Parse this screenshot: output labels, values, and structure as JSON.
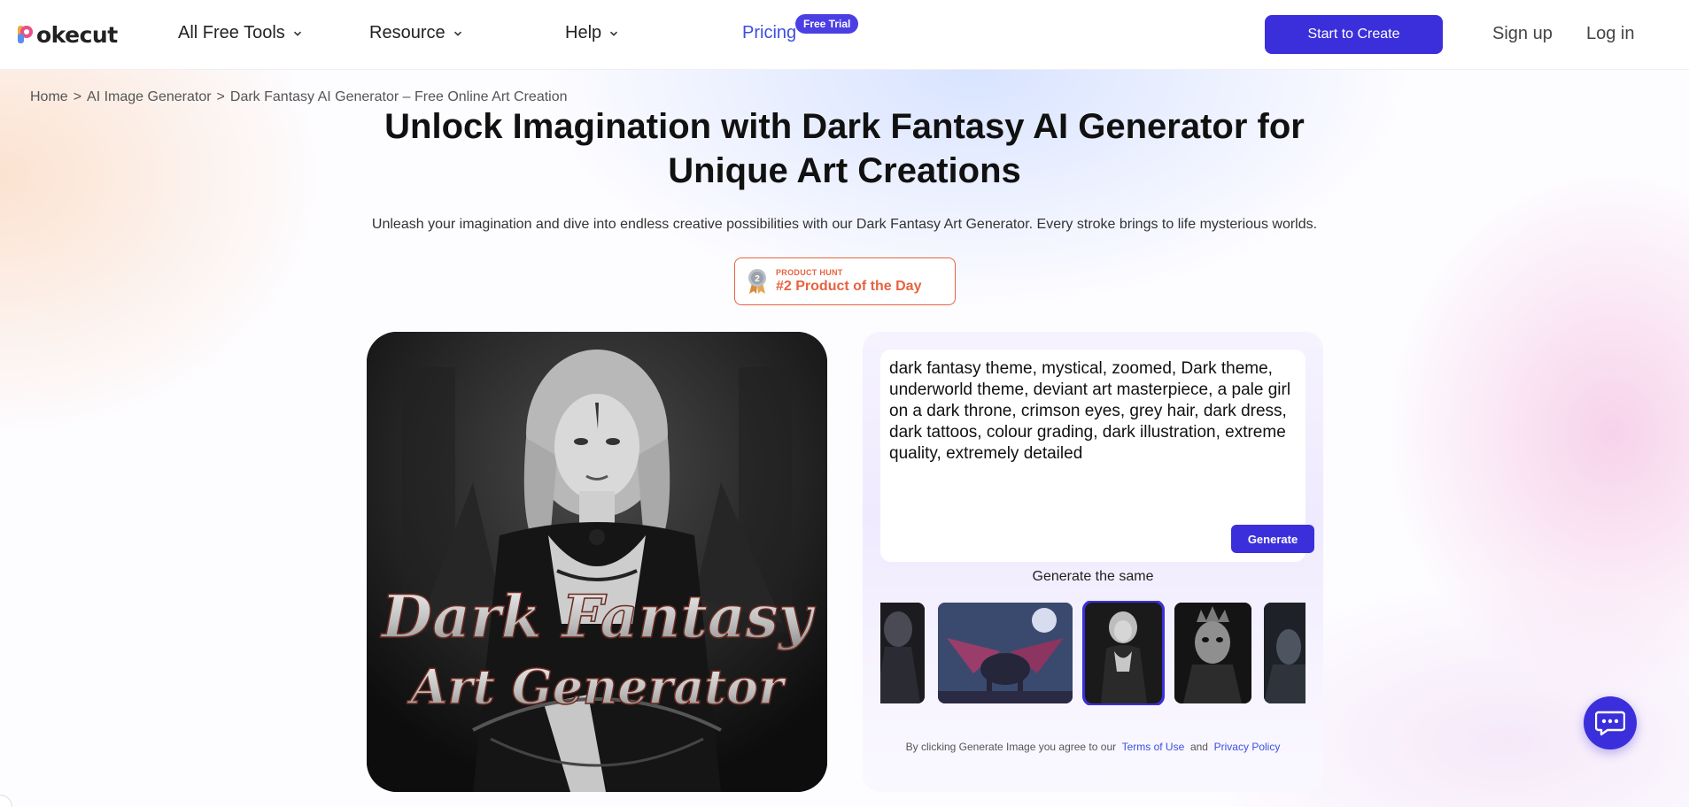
{
  "brand": {
    "name": "okecut",
    "logo_letter": "P"
  },
  "nav": {
    "items": [
      {
        "label": "All Free Tools"
      },
      {
        "label": "Resource"
      },
      {
        "label": "Help"
      }
    ],
    "pricing_label": "Pricing",
    "trial_badge": "Free Trial",
    "start_button": "Start to Create",
    "signup": "Sign up",
    "login": "Log in"
  },
  "breadcrumb": {
    "items": [
      "Home",
      ">",
      "AI Image Generator",
      ">",
      "Dark Fantasy AI Generator – Free Online Art Creation"
    ]
  },
  "hero": {
    "title": "Unlock Imagination with Dark Fantasy AI Generator for Unique Art Creations",
    "subtitle": "Unleash your imagination and dive into endless creative possibilities with our Dark Fantasy Art Generator. Every stroke brings to life mysterious worlds.",
    "badge_small": "PRODUCT HUNT",
    "badge_big": "#2 Product of the Day",
    "image_text_line1": "Dark Fantasy",
    "image_text_line2": "Art Generator"
  },
  "panel": {
    "prompt": "dark fantasy theme, mystical, zoomed, Dark theme, underworld theme, deviant art masterpiece, a pale girl on a dark throne, crimson eyes, grey hair, dark dress, dark tattoos, colour grading, dark illustration, extreme quality, extremely detailed",
    "generate_button": "Generate",
    "generate_same": "Generate the same",
    "terms_prefix": "By clicking Generate Image you agree to our",
    "terms_link": "Terms of Use",
    "terms_and": "and",
    "privacy_link": "Privacy Policy"
  },
  "colors": {
    "accent": "#3b2fdc",
    "link": "#3b4fe0",
    "badge_orange": "#e8623f"
  },
  "icons": [
    "chevron-down-icon",
    "medal-icon",
    "chat-icon"
  ]
}
